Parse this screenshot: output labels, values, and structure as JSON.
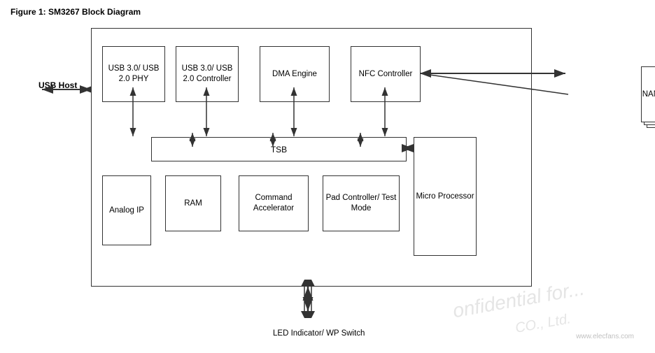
{
  "figure": {
    "title": "Figure 1:   SM3267 Block Diagram"
  },
  "labels": {
    "usb_host": "USB Host",
    "nand_flash": "NAND\nFlash Chips",
    "usb_phy": "USB 3.0/\nUSB 2.0\nPHY",
    "usb_controller": "USB 3.0/\nUSB 2.0\nController",
    "dma_engine": "DMA Engine",
    "nfc_controller": "NFC\nController",
    "tsb": "TSB",
    "analog_ip": "Analog\nIP",
    "ram": "RAM",
    "command_accelerator": "Command\nAccelerator",
    "pad_controller": "Pad Controller/\nTest Mode",
    "micro_processor": "Micro\nProcessor",
    "led_indicator": "LED Indicator/\nWP Switch"
  },
  "watermark": {
    "line1": "onfidential for...",
    "line2": "CO., Ltd."
  },
  "website": "www.elecfans.com"
}
